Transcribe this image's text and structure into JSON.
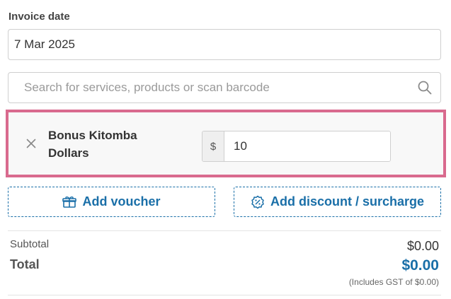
{
  "invoice_date": {
    "label": "Invoice date",
    "value": "7 Mar 2025"
  },
  "search": {
    "placeholder": "Search for services, products or scan barcode",
    "icon": "search-icon"
  },
  "line_item": {
    "name": "Bonus Kitomba Dollars",
    "currency_symbol": "$",
    "amount": "10",
    "highlight_color": "#d96a8e"
  },
  "actions": {
    "voucher_label": "Add voucher",
    "discount_label": "Add discount / surcharge",
    "accent_color": "#1a6fa8"
  },
  "totals": {
    "subtotal_label": "Subtotal",
    "subtotal_value": "$0.00",
    "total_label": "Total",
    "total_value": "$0.00",
    "gst_note": "(Includes GST of $0.00)"
  }
}
